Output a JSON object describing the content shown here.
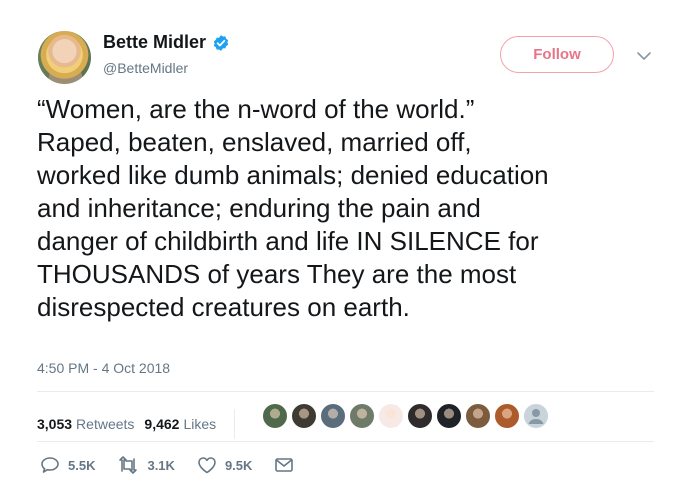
{
  "author": {
    "name": "Bette Midler",
    "handle": "@BetteMidler",
    "verified": true
  },
  "header": {
    "follow_label": "Follow"
  },
  "tweet": {
    "text": "“Women, are the n-word of the world.”\nRaped, beaten,  enslaved, married off,\nworked like dumb animals; denied education\nand inheritance; enduring the pain and\ndanger of childbirth and life IN SILENCE for\nTHOUSANDS of years They are the most\ndisrespected creatures on earth.",
    "timestamp": "4:50 PM - 4 Oct 2018"
  },
  "stats": {
    "retweets_count": "3,053",
    "retweets_label": "Retweets",
    "likes_count": "9,462",
    "likes_label": "Likes"
  },
  "likers": [
    {
      "icon": "liker-avatar-1",
      "color": "#4f6a4a"
    },
    {
      "icon": "liker-avatar-2",
      "color": "#3e3b34"
    },
    {
      "icon": "liker-avatar-3",
      "color": "#5a6d7d"
    },
    {
      "icon": "liker-avatar-4",
      "color": "#6f7b68"
    },
    {
      "icon": "liker-avatar-5",
      "color": "#f7e9e6"
    },
    {
      "icon": "liker-avatar-6",
      "color": "#2f2b2c"
    },
    {
      "icon": "liker-avatar-7",
      "color": "#1f2327"
    },
    {
      "icon": "liker-avatar-8",
      "color": "#7d5b3f"
    },
    {
      "icon": "liker-avatar-9",
      "color": "#ad5b2a"
    },
    {
      "icon": "default-avatar-icon",
      "color": "#c9d3da"
    }
  ],
  "actions": {
    "replies": "5.5K",
    "retweets": "3.1K",
    "likes": "9.5K"
  },
  "colors": {
    "follow_accent": "#e8748a",
    "verified_blue": "#1da1f2",
    "secondary_text": "#657786"
  }
}
